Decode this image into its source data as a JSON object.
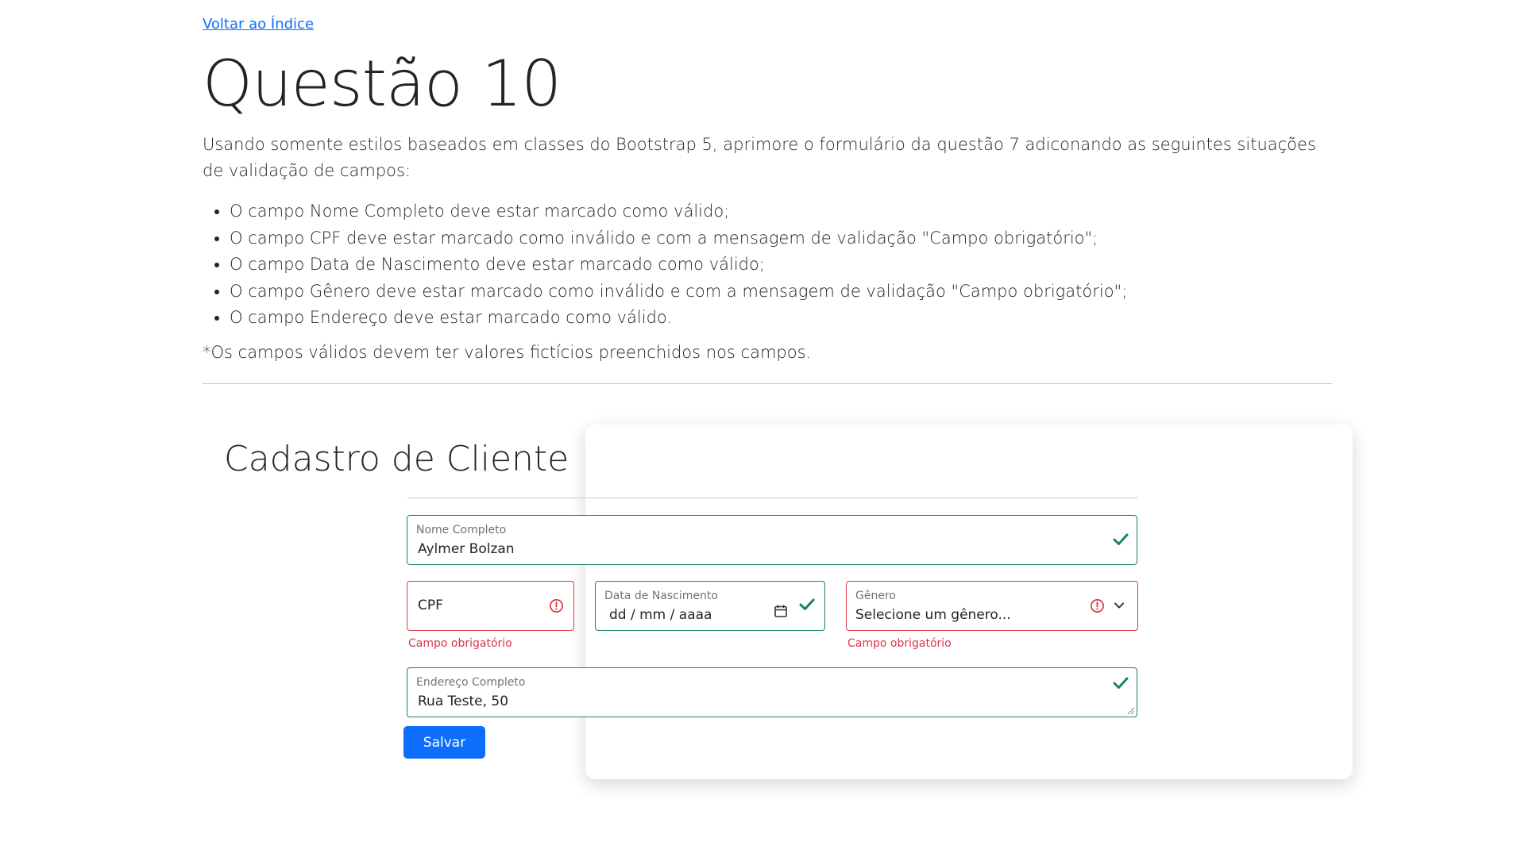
{
  "nav": {
    "back_link": "Voltar ao Índice"
  },
  "page": {
    "title": "Questão 10",
    "intro": "Usando somente estilos baseados em classes do Bootstrap 5, aprimore o formulário da questão 7 adiconando as seguintes situações de validação de campos:",
    "requirements": [
      "O campo Nome Completo deve estar marcado como válido;",
      "O campo CPF deve estar marcado como inválido e com a mensagem de validação \"Campo obrigatório\";",
      "O campo Data de Nascimento deve estar marcado como válido;",
      "O campo Gênero deve estar marcado como inválido e com a mensagem de validação \"Campo obrigatório\";",
      "O campo Endereço deve estar marcado como válido."
    ],
    "note": "*Os campos válidos devem ter valores fictícios preenchidos nos campos."
  },
  "form": {
    "title": "Cadastro de Cliente",
    "nome": {
      "label": "Nome Completo",
      "value": "Aylmer Bolzan",
      "state": "valid"
    },
    "cpf": {
      "placeholder": "CPF",
      "state": "invalid",
      "feedback": "Campo obrigatório"
    },
    "nascimento": {
      "label": "Data de Nascimento",
      "placeholder": "dd / mm / aaaa",
      "state": "valid"
    },
    "genero": {
      "label": "Gênero",
      "selected": "Selecione um gênero...",
      "state": "invalid",
      "feedback": "Campo obrigatório"
    },
    "endereco": {
      "label": "Endereço Completo",
      "value": "Rua Teste, 50",
      "state": "valid"
    },
    "save_label": "Salvar"
  },
  "colors": {
    "valid": "#198754",
    "invalid": "#dc3545",
    "primary": "#0d6efd",
    "link": "#0d6efd"
  },
  "icons": {
    "valid": "check-icon",
    "invalid": "exclamation-circle-icon",
    "calendar": "calendar-icon",
    "select": "chevron-down-icon",
    "resize": "resize-handle-icon"
  }
}
